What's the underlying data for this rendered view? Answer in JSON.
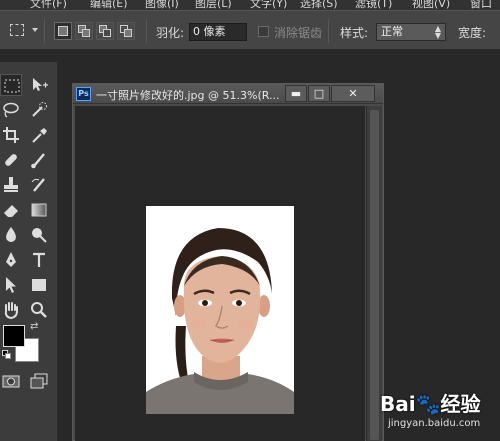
{
  "menubar": {
    "items": [
      "文件(F)",
      "编辑(E)",
      "图像(I)",
      "图层(L)",
      "文字(Y)",
      "选择(S)",
      "滤镜(T)",
      "视图(V)",
      "窗口"
    ]
  },
  "options": {
    "feather_label": "羽化:",
    "feather_value": "0 像素",
    "antialias_label": "消除锯齿",
    "style_label": "样式:",
    "style_value": "正常",
    "width_label": "宽度:"
  },
  "document": {
    "app_badge": "Ps",
    "title": "一寸照片修改好的.jpg @ 51.3%(R...",
    "minimize": "▬",
    "maximize": "□",
    "close": "✕"
  },
  "watermark": {
    "brand": "Bai🐾经验",
    "url": "jingyan.baidu.com"
  },
  "colors": {
    "foreground": "#000000",
    "background": "#ffffff",
    "workspace": "#282828",
    "panel": "#3c3c3c"
  }
}
